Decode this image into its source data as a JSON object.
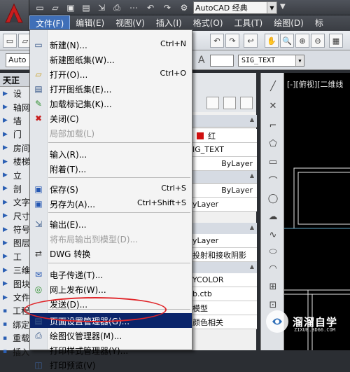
{
  "titlebar": {
    "workspace": "AutoCAD 经典"
  },
  "menubar": [
    {
      "label": "文件(F)"
    },
    {
      "label": "编辑(E)"
    },
    {
      "label": "视图(V)"
    },
    {
      "label": "插入(I)"
    },
    {
      "label": "格式(O)"
    },
    {
      "label": "工具(T)"
    },
    {
      "label": "绘图(D)"
    },
    {
      "label": "标"
    }
  ],
  "toolbar": {
    "tab_label": "Auto",
    "text_style": "SIG_TEXT"
  },
  "palette": {
    "title": "天正",
    "items": [
      "设",
      "轴网",
      "墙",
      "门",
      "房间",
      "楼梯",
      "立",
      "剖",
      "文字",
      "尺寸",
      "符号",
      "图层",
      "工",
      "三维",
      "图块",
      "文件"
    ],
    "bottom": [
      "工程",
      "绑定",
      "重载",
      "插入"
    ]
  },
  "properties": {
    "color": "红",
    "text_style": "IG_TEXT",
    "linetype": "ByLayer",
    "lineweight": "ByLayer",
    "plotstyle": "yLayer",
    "mat": "yLayer",
    "shadow": "投射和接收阴影",
    "plot_color": "YCOLOR",
    "plot_table": "b.ctb",
    "model": "模型",
    "related": "颜色相关"
  },
  "viewport": {
    "label": "[-][俯视][二维线"
  },
  "file_menu": [
    {
      "label": "新建(N)...",
      "shortcut": "Ctrl+N",
      "icon": "new-file-icon"
    },
    {
      "label": "新建图纸集(W)...",
      "shortcut": "",
      "icon": ""
    },
    {
      "label": "打开(O)...",
      "shortcut": "Ctrl+O",
      "icon": "open-folder-icon"
    },
    {
      "label": "打开图纸集(E)...",
      "shortcut": "",
      "icon": "open-sheetset-icon"
    },
    {
      "label": "加载标记集(K)...",
      "shortcut": "",
      "icon": "markup-icon"
    },
    {
      "label": "关闭(C)",
      "shortcut": "",
      "icon": "close-icon"
    },
    {
      "label": "局部加载(L)",
      "shortcut": "",
      "icon": "",
      "disabled": true
    },
    {
      "label": "输入(R)...",
      "shortcut": "",
      "icon": ""
    },
    {
      "label": "附着(T)...",
      "shortcut": "",
      "icon": ""
    },
    {
      "label": "保存(S)",
      "shortcut": "Ctrl+S",
      "icon": "save-icon"
    },
    {
      "label": "另存为(A)...",
      "shortcut": "Ctrl+Shift+S",
      "icon": "save-as-icon"
    },
    {
      "label": "输出(E)...",
      "shortcut": "",
      "icon": "export-icon"
    },
    {
      "label": "将布局输出到模型(D)...",
      "shortcut": "",
      "icon": "",
      "disabled": true
    },
    {
      "label": "DWG 转换",
      "shortcut": "",
      "icon": "dwg-convert-icon"
    },
    {
      "label": "电子传递(T)...",
      "shortcut": "",
      "icon": "etransmit-icon"
    },
    {
      "label": "网上发布(W)...",
      "shortcut": "",
      "icon": "web-publish-icon"
    },
    {
      "label": "发送(D)...",
      "shortcut": "",
      "icon": ""
    },
    {
      "label": "页面设置管理器(G)...",
      "shortcut": "",
      "icon": "page-setup-icon",
      "highlighted": true
    },
    {
      "label": "绘图仪管理器(M)...",
      "shortcut": "",
      "icon": "plotter-icon"
    },
    {
      "label": "打印样式管理器(Y)...",
      "shortcut": "",
      "icon": ""
    },
    {
      "label": "打印预览(V)",
      "shortcut": "",
      "icon": "preview-icon"
    }
  ],
  "watermark": {
    "title": "溜溜自学",
    "sub": "ZIXUE.3D66.COM"
  },
  "colors": {
    "highlight": "#0a246a",
    "annotation": "#e0262a",
    "menu_active": "#3f6fb8",
    "color_swatch": "#d01010"
  }
}
